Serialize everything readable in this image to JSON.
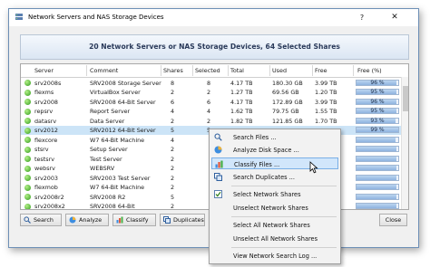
{
  "window": {
    "title": "Network Servers and NAS Storage Devices",
    "help_label": "?",
    "close_label": "✕"
  },
  "banner": {
    "text": "20 Network Servers or NAS Storage Devices, 64 Selected Shares"
  },
  "columns": [
    "Server",
    "Comment",
    "Shares",
    "Selected",
    "Total",
    "Used",
    "Free",
    "Free (%)"
  ],
  "rows": [
    {
      "server": "srv2008s",
      "comment": "SRV2008 Storage Server",
      "shares": "8",
      "selected": "8",
      "total": "4.17 TB",
      "used": "180.30 GB",
      "free": "3.99 TB",
      "free_pct": "96 %",
      "pct": 96,
      "selected_row": false
    },
    {
      "server": "flexms",
      "comment": "VirtualBox Server",
      "shares": "2",
      "selected": "2",
      "total": "1.27 TB",
      "used": "69.56 GB",
      "free": "1.20 TB",
      "free_pct": "95 %",
      "pct": 95,
      "selected_row": false
    },
    {
      "server": "srv2008",
      "comment": "SRV2008 64-Bit Server",
      "shares": "6",
      "selected": "6",
      "total": "4.17 TB",
      "used": "172.89 GB",
      "free": "3.99 TB",
      "free_pct": "96 %",
      "pct": 96,
      "selected_row": false
    },
    {
      "server": "repsrv",
      "comment": "Report Server",
      "shares": "4",
      "selected": "4",
      "total": "1.62 TB",
      "used": "79.75 GB",
      "free": "1.55 TB",
      "free_pct": "95 %",
      "pct": 95,
      "selected_row": false
    },
    {
      "server": "datasrv",
      "comment": "Data Server",
      "shares": "2",
      "selected": "2",
      "total": "1.82 TB",
      "used": "121.85 GB",
      "free": "1.70 TB",
      "free_pct": "93 %",
      "pct": 93,
      "selected_row": false
    },
    {
      "server": "srv2012",
      "comment": "SRV2012 64-Bit Server",
      "shares": "5",
      "selected": "5",
      "total": "",
      "used": "",
      "free": "",
      "free_pct": "99 %",
      "pct": 99,
      "selected_row": true
    },
    {
      "server": "flexcore",
      "comment": "W7 64-Bit Machine",
      "shares": "4",
      "selected": "",
      "total": "",
      "used": "",
      "free": "",
      "free_pct": "",
      "pct": 94,
      "selected_row": false
    },
    {
      "server": "stsrv",
      "comment": "Setup Server",
      "shares": "2",
      "selected": "",
      "total": "",
      "used": "",
      "free": "",
      "free_pct": "",
      "pct": 95,
      "selected_row": false
    },
    {
      "server": "testsrv",
      "comment": "Test Server",
      "shares": "2",
      "selected": "",
      "total": "",
      "used": "",
      "free": "",
      "free_pct": "",
      "pct": 95,
      "selected_row": false
    },
    {
      "server": "websrv",
      "comment": "WEBSRV",
      "shares": "2",
      "selected": "",
      "total": "",
      "used": "",
      "free": "",
      "free_pct": "",
      "pct": 96,
      "selected_row": false
    },
    {
      "server": "srv2003",
      "comment": "SRV2003 Test Server",
      "shares": "2",
      "selected": "",
      "total": "",
      "used": "",
      "free": "",
      "free_pct": "",
      "pct": 95,
      "selected_row": false
    },
    {
      "server": "flexmob",
      "comment": "W7 64-Bit Machine",
      "shares": "2",
      "selected": "",
      "total": "",
      "used": "",
      "free": "",
      "free_pct": "",
      "pct": 95,
      "selected_row": false
    },
    {
      "server": "srv2008r2",
      "comment": "SRV2008 R2",
      "shares": "5",
      "selected": "",
      "total": "",
      "used": "",
      "free": "",
      "free_pct": "",
      "pct": 95,
      "selected_row": false
    },
    {
      "server": "srv2008x2",
      "comment": "SRV2008 64-Bit",
      "shares": "2",
      "selected": "",
      "total": "",
      "used": "",
      "free": "",
      "free_pct": "",
      "pct": 95,
      "selected_row": false
    }
  ],
  "buttons": {
    "search": "Search",
    "analyze": "Analyze",
    "classify": "Classify",
    "duplicates": "Duplicates",
    "close": "Close"
  },
  "context_menu": {
    "search_files": "Search Files ...",
    "analyze_disk_space": "Analyze Disk Space ...",
    "classify_files": "Classify Files ...",
    "search_duplicates": "Search Duplicates ...",
    "select_network_shares": "Select Network Shares",
    "unselect_network_shares": "Unselect Network Shares",
    "select_all_network_shares": "Select All Network Shares",
    "unselect_all_network_shares": "Unselect All Network Shares",
    "view_network_search_log": "View Network Search Log ..."
  },
  "colors": {
    "accent": "#2e9a1a",
    "selection": "#cce4f7",
    "menu_highlight": "#d1e6fb",
    "banner_text": "#2a3a5a"
  }
}
